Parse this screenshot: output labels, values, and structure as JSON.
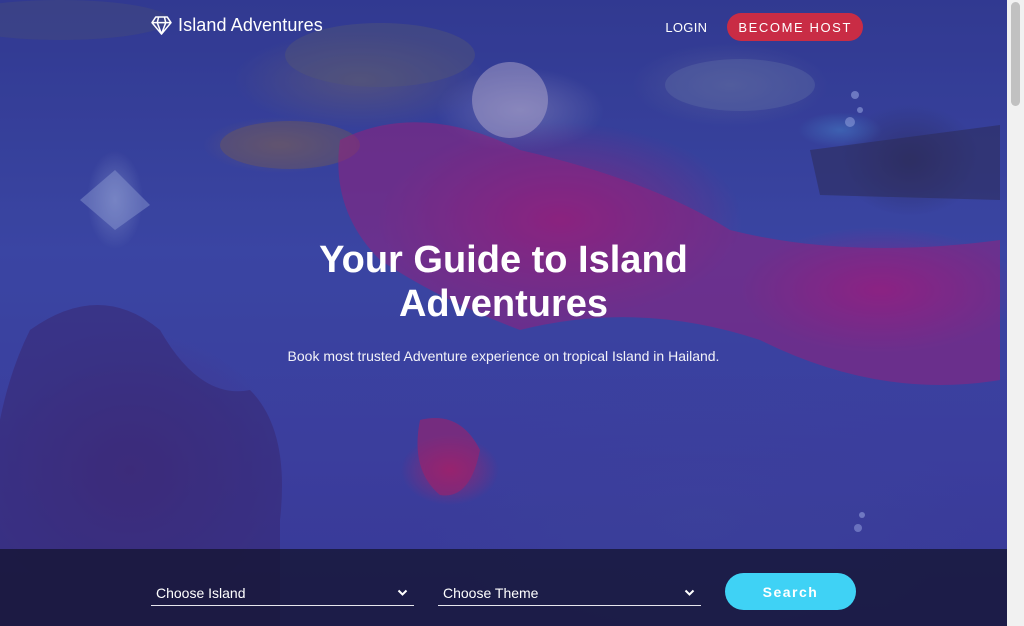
{
  "brand": {
    "name": "Island Adventures",
    "logo_icon": "diamond-icon"
  },
  "nav": {
    "login": "LOGIN",
    "become_host": "BECOME HOST"
  },
  "hero": {
    "headline_line1": "Your Guide to Island",
    "headline_line2": "Adventures",
    "subhead": "Book most trusted Adventure experience on tropical Island in Hailand."
  },
  "search": {
    "island_select": "Choose Island",
    "theme_select": "Choose Theme",
    "button": "Search"
  },
  "colors": {
    "accent_host": "#c92c45",
    "accent_search": "#3fd2f5",
    "overlay": "#3b3f9a"
  }
}
